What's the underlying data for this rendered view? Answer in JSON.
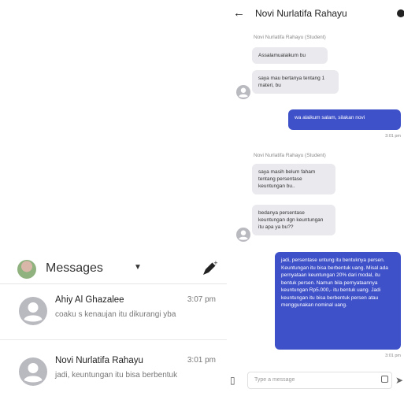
{
  "left_panel": {
    "header": {
      "title": "Messages",
      "caret": "▼",
      "compose_icon": "compose-icon"
    },
    "conversations": [
      {
        "name": "Ahiy Al Ghazalee",
        "time": "3:07 pm",
        "preview": "coaku s kenaujan itu dikurangi yba"
      },
      {
        "name": "Novi Nurlatifa Rahayu",
        "time": "3:01 pm",
        "preview": "jadi, keuntungan itu bisa berbentuk"
      }
    ]
  },
  "chat": {
    "back_icon": "←",
    "title": "Novi Nurlatifa Rahayu",
    "messages": [
      {
        "sender": "Novi Nurlatifa Rahayu (Student)"
      },
      {
        "text": "Assalamualaikum bu"
      },
      {
        "text": "saya mau bertanya tentang 1 materi, bu"
      },
      {
        "text": "wa alaikum salam, silakan novi"
      },
      {
        "time": "3:01 pm"
      },
      {
        "sender": "Novi Nurlatifa Rahayu (Student)"
      },
      {
        "text": "saya masih belum faham tentang persentase keuntungan bu.."
      },
      {
        "text": "bedanya persentase keuntungan dgn keuntungan itu apa ya bu??"
      },
      {
        "text": "jadi, persentase untung itu bentuknya persen. Keuntungan itu bisa berbentuk uang. Misal ada pernyataan keuntungan 20% dari modal, itu bentuk persen. Namun bila pernyataannya keuntungan Rp5.000,- itu bentuk uang. Jadi keuntungan itu bisa berbentuk persen atau menggunakan nominal uang."
      },
      {
        "time": "3:01 pm"
      }
    ],
    "composer": {
      "placeholder": "Type a message",
      "attach_icon": "paperclip-icon",
      "send_icon": "send-icon"
    }
  },
  "colors": {
    "outgoing_bubble": "#3f51c9",
    "incoming_bubble": "#e9e9ee",
    "avatar_placeholder": "#b9b9c0"
  }
}
